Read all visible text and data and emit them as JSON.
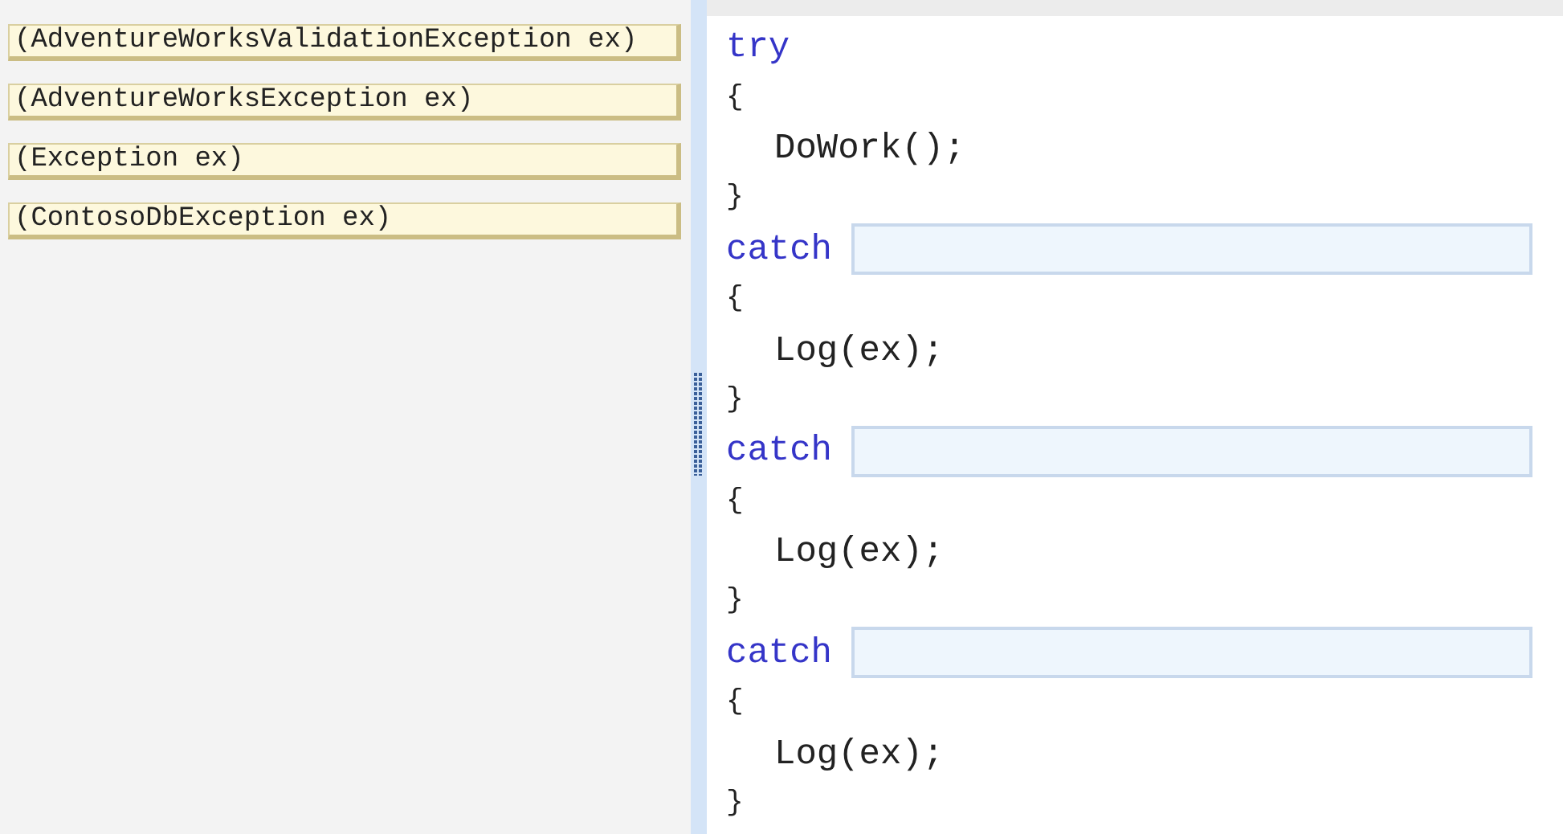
{
  "answer_choices": [
    {
      "text": "(AdventureWorksValidationException ex)"
    },
    {
      "text": "(AdventureWorksException ex)"
    },
    {
      "text": "(Exception ex)"
    },
    {
      "text": "(ContosoDbException ex)"
    }
  ],
  "code_lines": [
    {
      "kind": "keyword",
      "text": "try"
    },
    {
      "kind": "brace",
      "text": "{"
    },
    {
      "kind": "statement",
      "text": "DoWork();"
    },
    {
      "kind": "brace",
      "text": "}"
    },
    {
      "kind": "catch",
      "text": "catch"
    },
    {
      "kind": "brace",
      "text": "{"
    },
    {
      "kind": "statement",
      "text": "Log(ex);"
    },
    {
      "kind": "brace",
      "text": "}"
    },
    {
      "kind": "catch",
      "text": "catch"
    },
    {
      "kind": "brace",
      "text": "{"
    },
    {
      "kind": "statement",
      "text": "Log(ex);"
    },
    {
      "kind": "brace",
      "text": "}"
    },
    {
      "kind": "catch",
      "text": "catch"
    },
    {
      "kind": "brace",
      "text": "{"
    },
    {
      "kind": "statement",
      "text": "Log(ex);"
    },
    {
      "kind": "brace",
      "text": "}"
    }
  ]
}
